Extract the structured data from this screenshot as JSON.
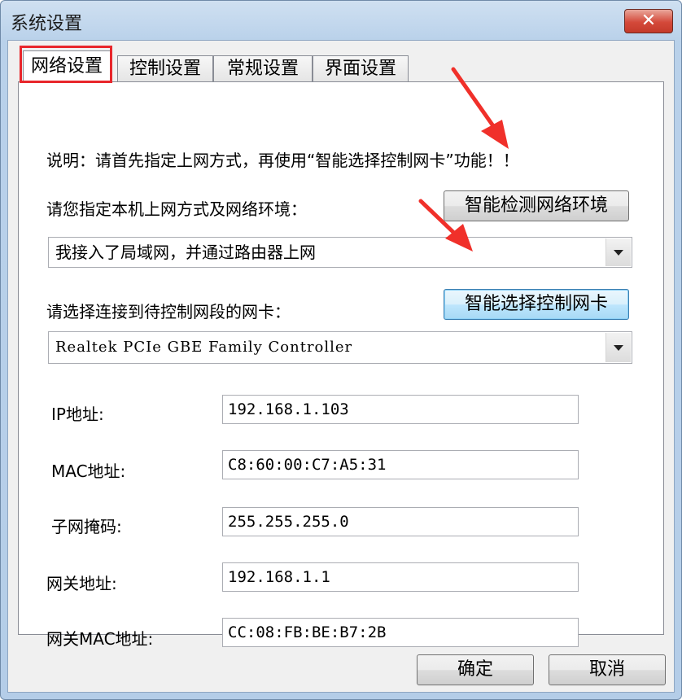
{
  "window": {
    "title": "系统设置",
    "close_label": "✕"
  },
  "tabs": [
    {
      "label": "网络设置",
      "active": true
    },
    {
      "label": "控制设置",
      "active": false
    },
    {
      "label": "常规设置",
      "active": false
    },
    {
      "label": "界面设置",
      "active": false
    }
  ],
  "network": {
    "note": "说明：请首先指定上网方式，再使用“智能选择控制网卡”功能！！",
    "mode_label": "请您指定本机上网方式及网络环境：",
    "detect_button": "智能检测网络环境",
    "mode_value": "我接入了局域网，并通过路由器上网",
    "nic_label": "请选择连接到待控制网段的网卡：",
    "select_nic_button": "智能选择控制网卡",
    "nic_value": "Realtek PCIe GBE Family Controller",
    "fields": [
      {
        "label": "IP地址:",
        "value": "192.168.1.103"
      },
      {
        "label": "MAC地址:",
        "value": "C8:60:00:C7:A5:31"
      },
      {
        "label": "子网掩码:",
        "value": "255.255.255.0"
      },
      {
        "label": "网关地址:",
        "value": "192.168.1.1"
      },
      {
        "label": "网关MAC地址:",
        "value": "CC:08:FB:BE:B7:2B"
      }
    ]
  },
  "footer": {
    "ok_label": "确定",
    "cancel_label": "取消"
  },
  "colors": {
    "highlight": "#e8262b",
    "annotation_arrow": "#f0302a"
  }
}
